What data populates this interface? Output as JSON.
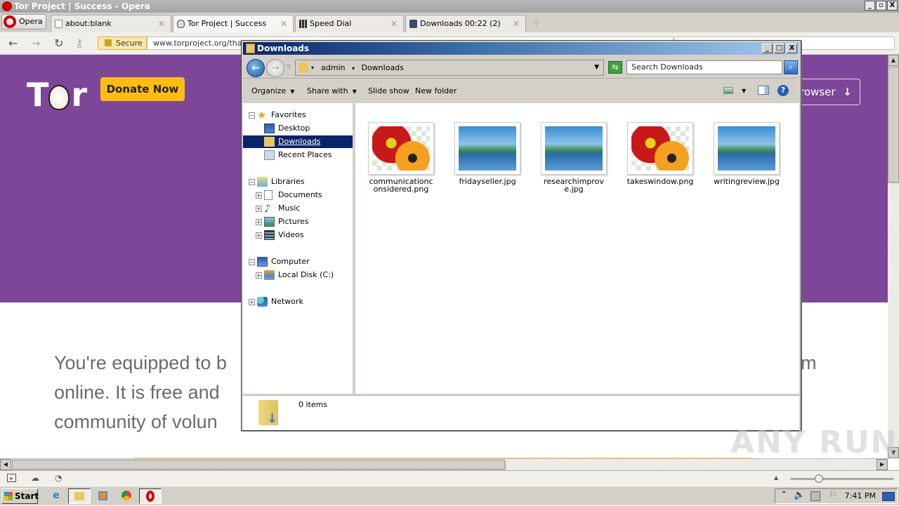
{
  "browser": {
    "window_title": "Tor Project | Success - Opera",
    "menu_button": "Opera",
    "tabs": [
      {
        "label": "about:blank",
        "icon": "page-icon"
      },
      {
        "label": "Tor Project | Success",
        "icon": "onion-icon",
        "active": true
      },
      {
        "label": "Speed Dial",
        "icon": "grid-icon"
      },
      {
        "label": "Downloads 00:22 (2)",
        "icon": "download-icon"
      }
    ],
    "security_label": "Secure",
    "url": "www.torproject.org/thank"
  },
  "page": {
    "logo_text_left": "T",
    "logo_text_right": "r",
    "donate_label": "Donate Now",
    "download_button_label": "rowser",
    "body_lines": [
      "You're equipped to b",
      "online. It is free and",
      "community of volun"
    ],
    "body_trailing": "m",
    "hero_color": "#7d4698",
    "donate_color": "#ffbd13"
  },
  "explorer": {
    "title": "Downloads",
    "breadcrumb": [
      "admin",
      "Downloads"
    ],
    "search_placeholder": "Search Downloads",
    "commands": {
      "organize": "Organize",
      "share_with": "Share with",
      "slide_show": "Slide show",
      "new_folder": "New folder"
    },
    "nav": {
      "favorites": "Favorites",
      "desktop": "Desktop",
      "downloads": "Downloads",
      "recent_places": "Recent Places",
      "libraries": "Libraries",
      "documents": "Documents",
      "music": "Music",
      "pictures": "Pictures",
      "videos": "Videos",
      "computer": "Computer",
      "local_disk": "Local Disk (C:)",
      "network": "Network"
    },
    "files": [
      {
        "name": "communicationconsidered.png",
        "thumb": "flower"
      },
      {
        "name": "fridayseller.jpg",
        "thumb": "landscape"
      },
      {
        "name": "researchimprove.jpg",
        "thumb": "landscape"
      },
      {
        "name": "takeswindow.png",
        "thumb": "flower"
      },
      {
        "name": "writingreview.jpg",
        "thumb": "landscape"
      }
    ],
    "status": "0 items"
  },
  "taskbar": {
    "start_label": "Start",
    "clock": "7:41 PM"
  },
  "watermark": "ANY RUN"
}
